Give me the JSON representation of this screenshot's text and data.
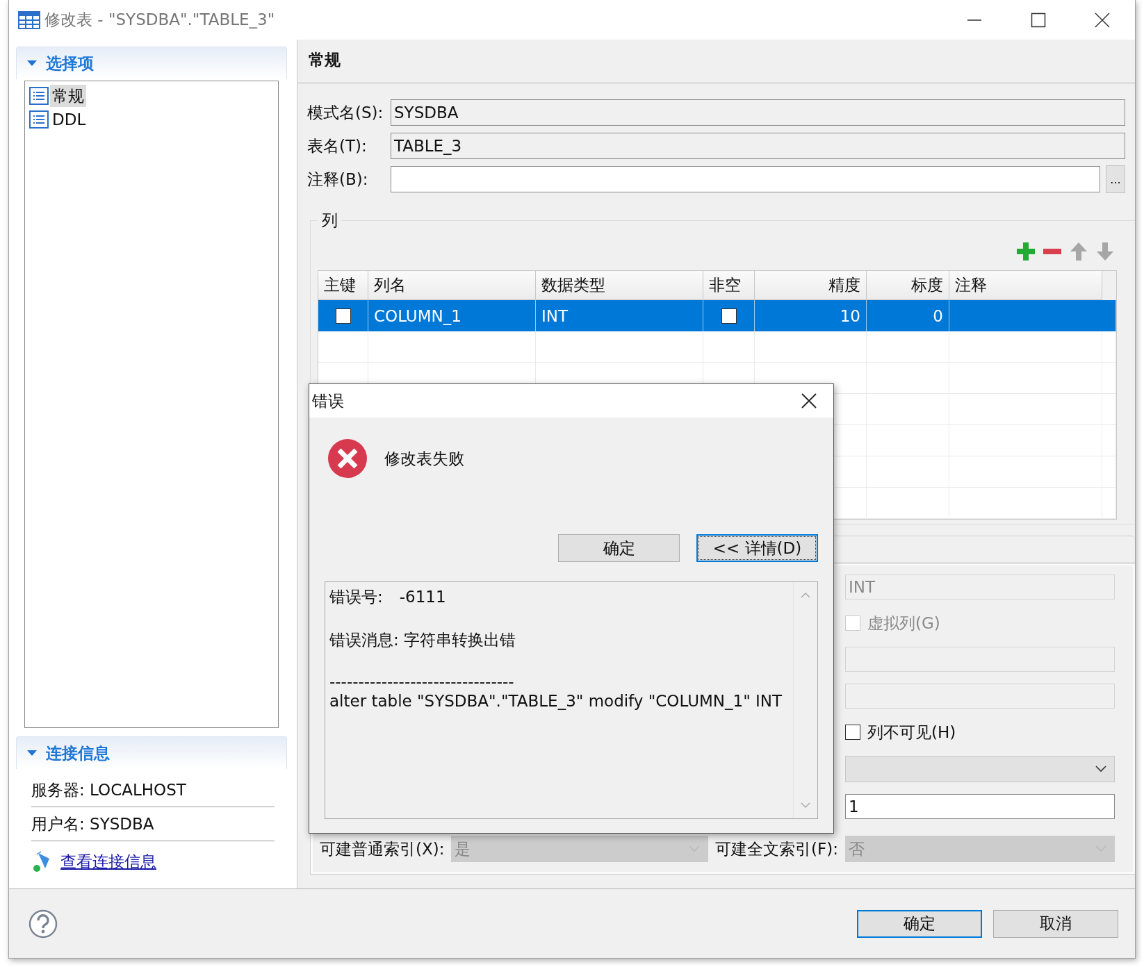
{
  "window": {
    "title": "修改表 - \"SYSDBA\".\"TABLE_3\""
  },
  "sidebar": {
    "options": {
      "title": "选择项",
      "expanded": true,
      "items": [
        {
          "label": "常规",
          "selected": true
        },
        {
          "label": "DDL",
          "selected": false
        }
      ]
    },
    "connection": {
      "title": "连接信息",
      "expanded": true,
      "server": "服务器: LOCALHOST",
      "user": "用户名: SYSDBA",
      "link": "查看连接信息"
    }
  },
  "page": {
    "title": "常规",
    "fields": [
      {
        "label": "模式名(S):",
        "value": "SYSDBA",
        "editable": false
      },
      {
        "label": "表名(T):",
        "value": "TABLE_3",
        "editable": false
      },
      {
        "label": "注释(B):",
        "editable": true,
        "button": "..."
      }
    ]
  },
  "columns": {
    "title": "列",
    "toolbar": [
      {
        "kind": "add",
        "disabled": false
      },
      {
        "kind": "remove",
        "disabled": false
      },
      {
        "kind": "up",
        "disabled": true
      },
      {
        "kind": "down",
        "disabled": true
      }
    ],
    "table": {
      "columns": [
        {
          "label": "主键"
        },
        {
          "label": "列名"
        },
        {
          "label": "数据类型"
        },
        {
          "label": "非空"
        },
        {
          "label": "精度"
        },
        {
          "label": "标度"
        },
        {
          "label": "注释"
        }
      ],
      "rows": [
        {
          "selected": true,
          "primary_key": false,
          "name": "COLUMN_1",
          "type": "INT",
          "not_null": false,
          "precision": "10",
          "scale": "0"
        }
      ]
    }
  },
  "details": {
    "type": {
      "value": "INT",
      "disabled": true
    },
    "virtual": {
      "label": "虚拟列(G)",
      "checked": false,
      "disabled": true
    },
    "invisible": {
      "label": "列不可见(H)",
      "checked": false,
      "disabled": false
    },
    "number": {
      "value": "1",
      "disabled": false
    },
    "normal_index": {
      "label": "可建普通索引(X):",
      "value": "是",
      "disabled": true
    },
    "fulltext_index": {
      "label": "可建全文索引(F):",
      "value": "否",
      "disabled": true
    }
  },
  "dialog": {
    "title": "错误",
    "message": "修改表失败",
    "buttons": [
      {
        "label": "确定",
        "focused": false
      },
      {
        "label": "<< 详情(D)",
        "focused": true
      }
    ],
    "details": {
      "code_label": "错误号:",
      "code": "-6111",
      "message": "错误消息: 字符串转换出错",
      "separator": "--------------------------------",
      "sql": "alter table \"SYSDBA\".\"TABLE_3\" modify \"COLUMN_1\" INT"
    }
  },
  "footer": {
    "buttons": [
      {
        "label": "确定",
        "focused": true
      },
      {
        "label": "取消",
        "focused": false
      }
    ]
  }
}
